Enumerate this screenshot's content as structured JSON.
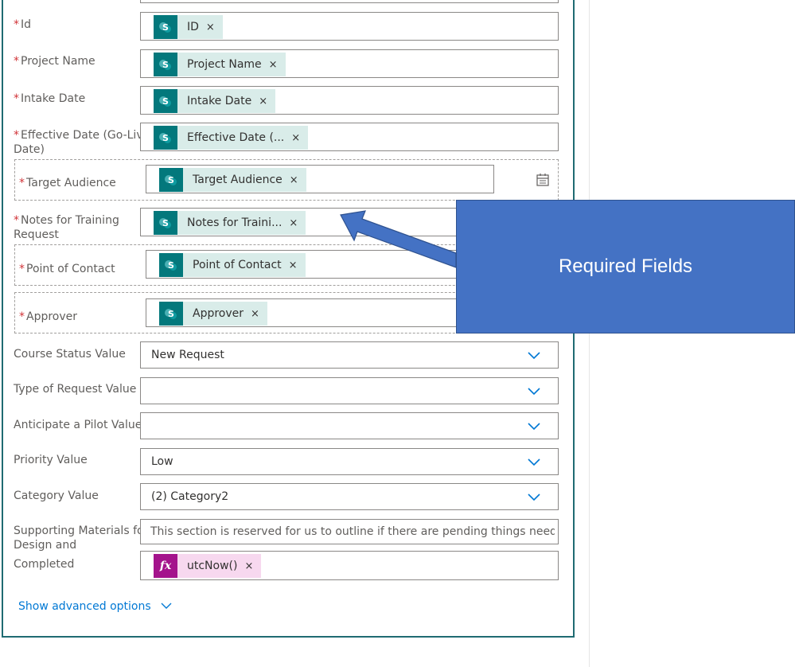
{
  "fields": {
    "id": {
      "label": "Id",
      "token": "ID"
    },
    "project_name": {
      "label": "Project Name",
      "token": "Project Name"
    },
    "intake_date": {
      "label": "Intake Date",
      "token": "Intake Date"
    },
    "effective_date": {
      "label_line1": "Effective Date (Go-Live",
      "label_line2": "Date)",
      "token": "Effective Date (..."
    },
    "target_audience": {
      "label": "Target Audience",
      "token": "Target Audience"
    },
    "notes_training": {
      "label_line1": "Notes for Training",
      "label_line2": "Request",
      "token": "Notes for Traini..."
    },
    "point_of_contact": {
      "label": "Point of Contact",
      "token": "Point of Contact"
    },
    "approver": {
      "label": "Approver",
      "token": "Approver"
    },
    "course_status": {
      "label": "Course Status Value",
      "value": "New Request"
    },
    "type_of_request": {
      "label": "Type of Request Value",
      "value": ""
    },
    "anticipate_pilot": {
      "label": "Anticipate a Pilot Value",
      "value": ""
    },
    "priority": {
      "label": "Priority Value",
      "value": "Low"
    },
    "category": {
      "label": "Category Value",
      "value": "(2) Category2"
    },
    "supporting_materials": {
      "label_line1": "Supporting Materials for",
      "label_line2": "Design and",
      "value": "This section is reserved for us to outline if there are pending things needed to c"
    },
    "completed": {
      "label": "Completed",
      "token": "utcNow()"
    }
  },
  "required_marker": "*",
  "token_remove": "×",
  "sharepoint_icon_letter": "S",
  "fx_icon_text": "fx",
  "advanced_options": "Show advanced options",
  "callout_text": "Required Fields",
  "colors": {
    "accent": "#0078d4",
    "sharepoint": "#03787c",
    "callout": "#4472c4",
    "required": "#d13438"
  }
}
